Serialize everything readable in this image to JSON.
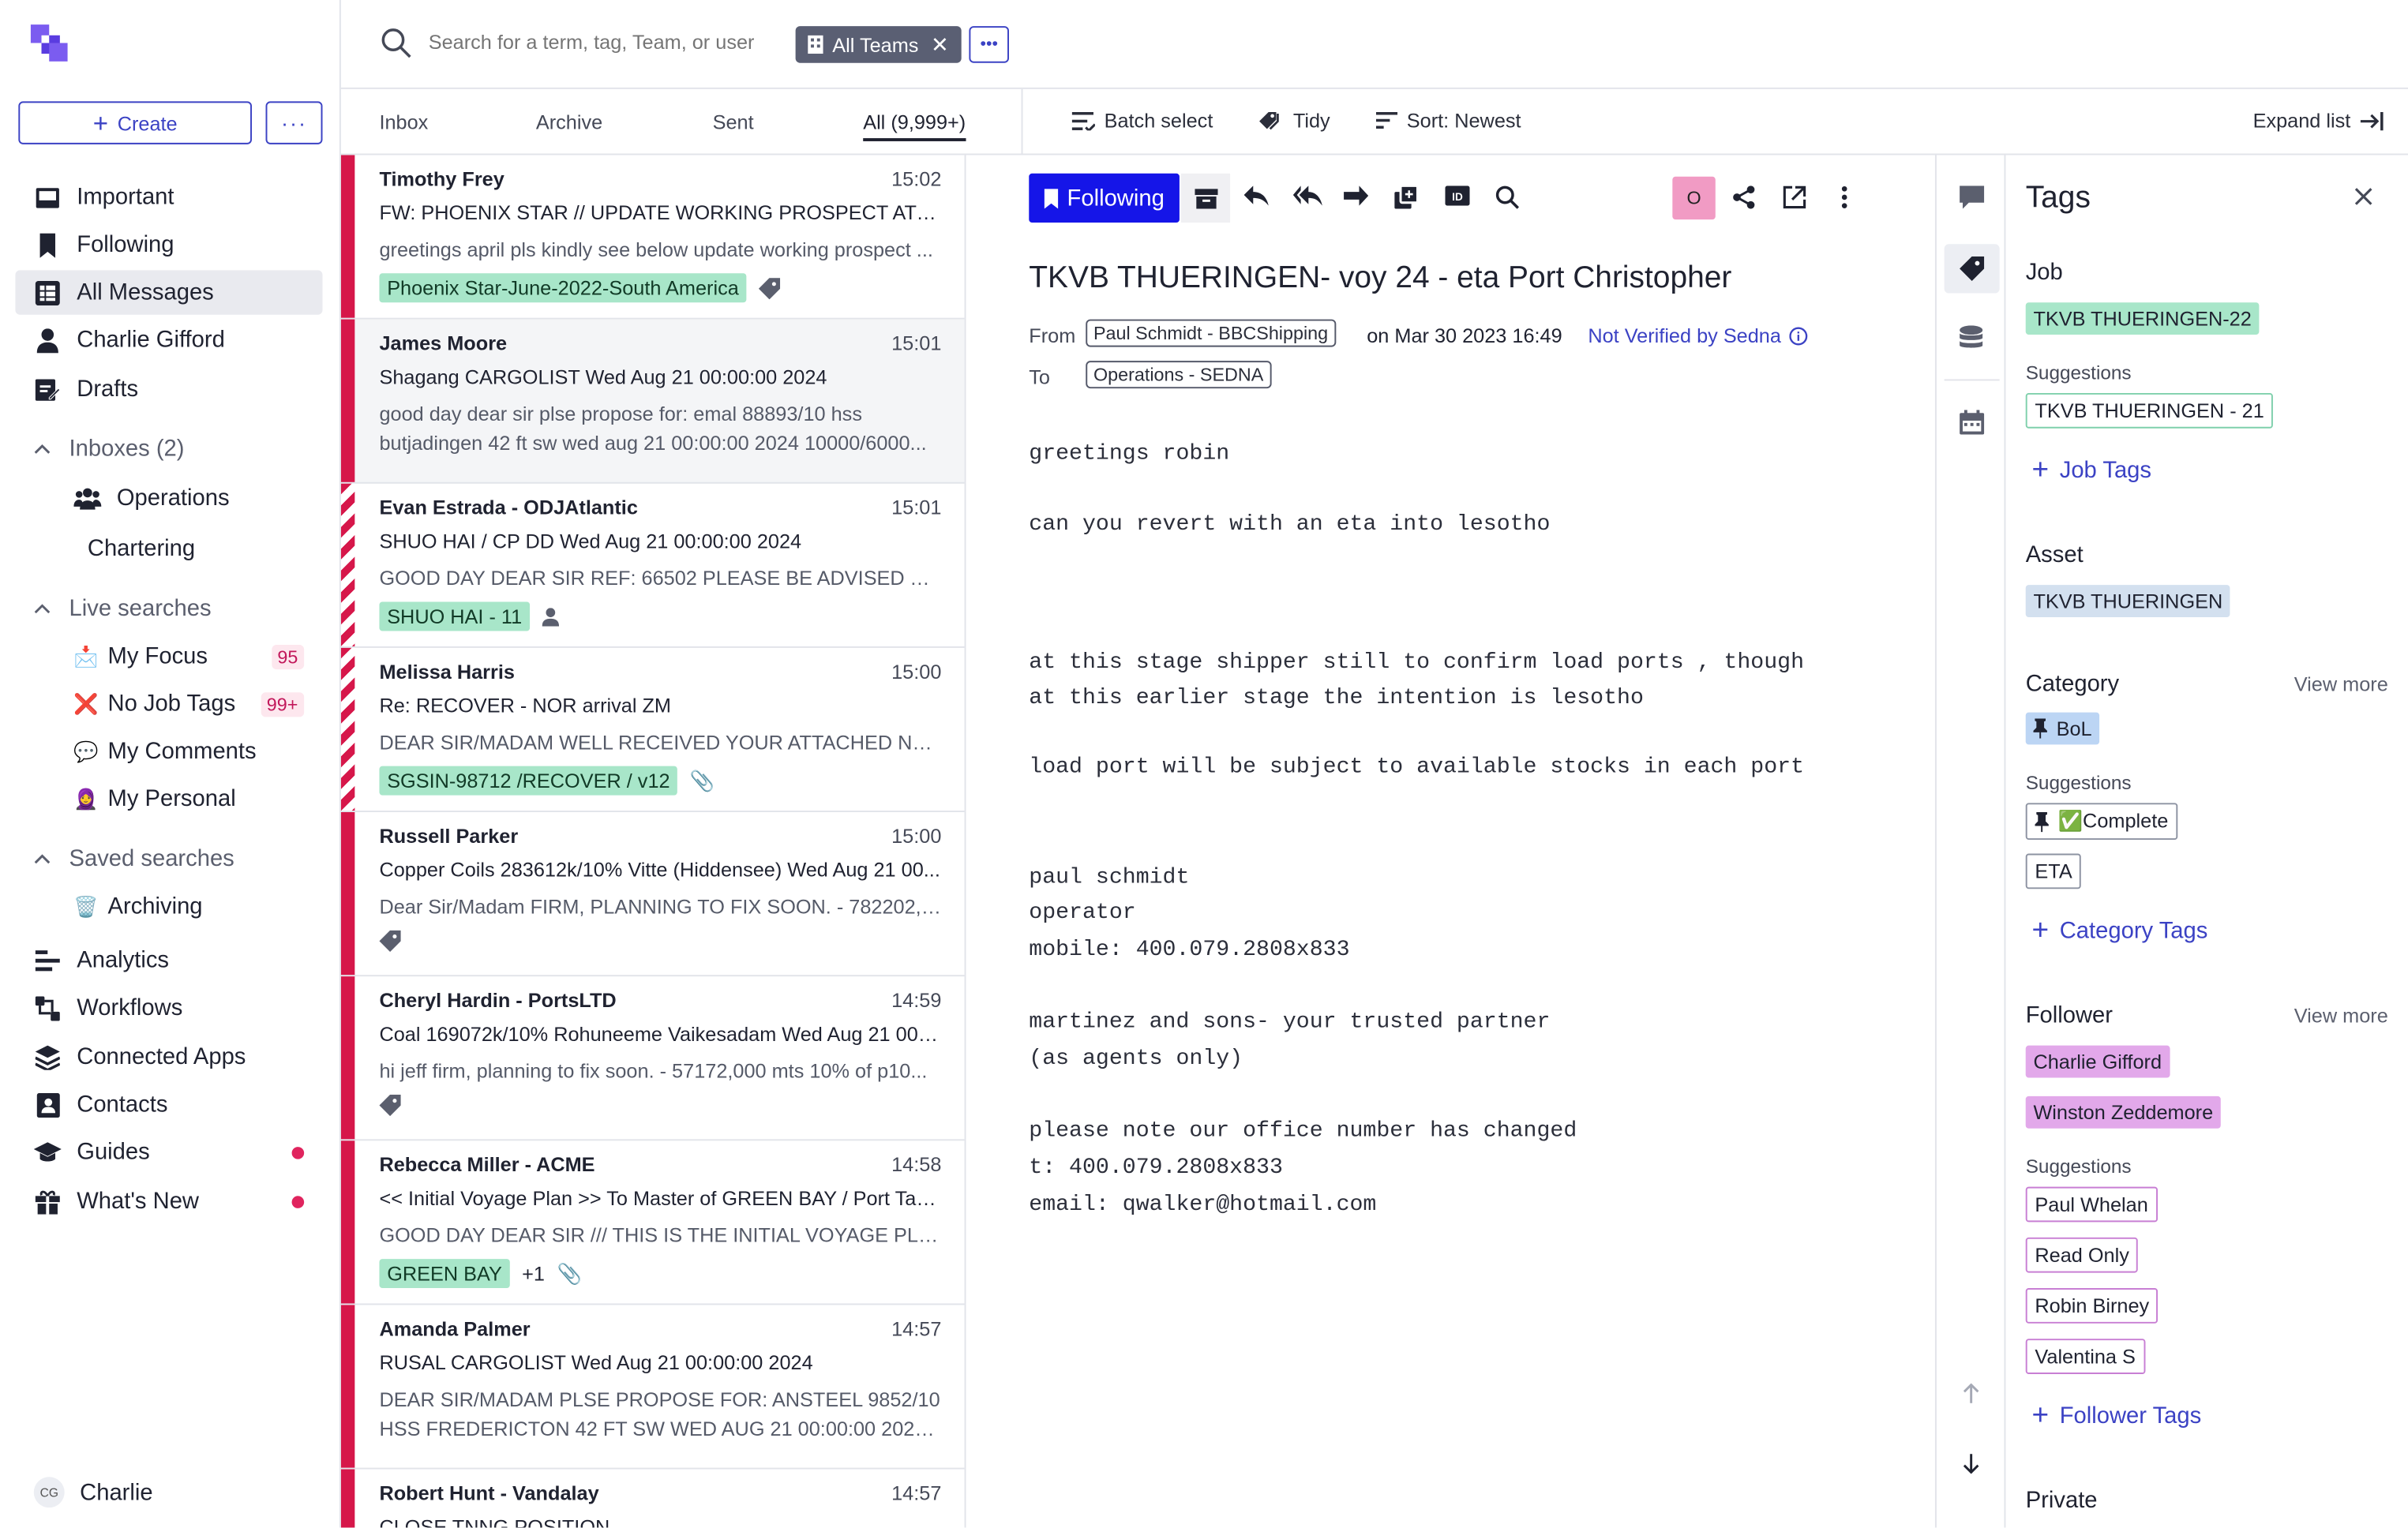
{
  "sidebar": {
    "create_label": "Create",
    "more_label": "···",
    "nav": [
      {
        "label": "Important",
        "icon": "inbox-icon"
      },
      {
        "label": "Following",
        "icon": "bookmark-icon"
      },
      {
        "label": "All Messages",
        "icon": "grid-icon"
      },
      {
        "label": "Charlie Gifford",
        "icon": "person-icon"
      },
      {
        "label": "Drafts",
        "icon": "draft-icon"
      }
    ],
    "inboxes_label": "Inboxes (2)",
    "inboxes": [
      {
        "label": "Operations"
      },
      {
        "label": "Chartering"
      }
    ],
    "live_label": "Live searches",
    "live": [
      {
        "label": "My Focus",
        "emoji": "📩",
        "count": "95"
      },
      {
        "label": "No Job Tags",
        "emoji": "❌",
        "count": "99+"
      },
      {
        "label": "My Comments",
        "emoji": "💬"
      },
      {
        "label": "My Personal",
        "emoji": "🧕"
      }
    ],
    "saved_label": "Saved searches",
    "saved": [
      {
        "label": "Archiving",
        "emoji": "🗑️"
      }
    ],
    "bottom_nav": [
      {
        "label": "Analytics"
      },
      {
        "label": "Workflows"
      },
      {
        "label": "Connected Apps"
      },
      {
        "label": "Contacts"
      },
      {
        "label": "Guides"
      },
      {
        "label": "What's New"
      }
    ],
    "user_initials": "CG",
    "user_name": "Charlie"
  },
  "search": {
    "placeholder": "Search for a term, tag, Team, or user",
    "teams_chip": "All Teams"
  },
  "tabs": {
    "inbox": "Inbox",
    "archive": "Archive",
    "sent": "Sent",
    "all": "All (9,999+)",
    "batch": "Batch select",
    "tidy": "Tidy",
    "sort": "Sort: Newest",
    "expand": "Expand list"
  },
  "messages": [
    {
      "from": "Timothy Frey",
      "time": "15:02",
      "subject": "FW: PHOENIX STAR // UPDATE WORKING PROSPECT AT Han...",
      "preview": [
        "greetings april pls kindly see below update working prospect ..."
      ],
      "tag": "Phoenix Star-June-2022-South America"
    },
    {
      "from": "James Moore",
      "time": "15:01",
      "subject": "Shagang CARGOLIST Wed Aug 21 00:00:00 2024",
      "preview": [
        "good day dear sir plse propose for: emal 88893/10 hss",
        "butjadingen 42 ft sw wed aug 21 00:00:00 2024 10000/6000..."
      ]
    },
    {
      "from": "Evan Estrada - ODJAtlantic",
      "time": "15:01",
      "subject": "SHUO HAI / CP DD Wed Aug 21 00:00:00 2024",
      "preview": [
        "GOOD DAY DEAR SIR REF: 66502 PLEASE BE ADVISED THAT..."
      ],
      "tag": "SHUO HAI - 11"
    },
    {
      "from": "Melissa Harris",
      "time": "15:00",
      "subject": "Re: RECOVER - NOR arrival ZM",
      "preview": [
        "DEAR SIR/MADAM WELL RECEIVED YOUR ATTACHED NOR ..."
      ],
      "tag": "SGSIN-98712 /RECOVER / v12"
    },
    {
      "from": "Russell Parker",
      "time": "15:00",
      "subject": "Copper Coils 283612k/10% Vitte (Hiddensee) Wed Aug 21 00...",
      "preview": [
        "Dear Sir/Madam FIRM, PLANNING TO FIX SOON. - 782202,0..."
      ]
    },
    {
      "from": "Cheryl Hardin - PortsLTD",
      "time": "14:59",
      "subject": "Coal 169072k/10% Rohuneeme Vaikesadam Wed Aug 21 00:0...",
      "preview": [
        "hi jeff firm, planning to fix soon. - 57172,000 mts 10% of p10..."
      ]
    },
    {
      "from": "Rebecca Miller - ACME",
      "time": "14:58",
      "subject": "<< Initial Voyage Plan >> To Master of GREEN BAY / Port Tan...",
      "preview": [
        "GOOD DAY DEAR SIR /// THIS IS THE INITIAL VOYAGE PLAN ..."
      ],
      "tag": "GREEN BAY",
      "extra": "+1"
    },
    {
      "from": "Amanda Palmer",
      "time": "14:57",
      "subject": "RUSAL CARGOLIST Wed Aug 21 00:00:00 2024",
      "preview": [
        "DEAR SIR/MADAM PLSE PROPOSE FOR: ANSTEEL 9852/10",
        "HSS FREDERICTON 42 FT SW WED AUG 21 00:00:00 2024..."
      ]
    },
    {
      "from": "Robert Hunt - Vandalay",
      "time": "14:57",
      "subject": "CLOSE TNNG POSITION",
      "preview": []
    }
  ],
  "reader": {
    "following_label": "Following",
    "avatar_letter": "O",
    "subject": "TKVB THUERINGEN- voy 24 - eta Port Christopher",
    "from_label": "From",
    "from_addr": "Paul Schmidt - BBCShipping",
    "date": "on Mar 30 2023 16:49",
    "verify": "Not Verified by Sedna",
    "to_label": "To",
    "to_addr": "Operations - SEDNA",
    "body": [
      "greetings robin",
      "can you revert with an eta into lesotho",
      "at this stage shipper still to confirm load ports , though",
      "at this earlier stage the intention is lesotho",
      "load port will be subject to available stocks in each port",
      "paul schmidt",
      "operator",
      "mobile: 400.079.2808x833",
      "martinez and sons- your trusted partner",
      "(as agents only)",
      "please note our office number has changed",
      "t: 400.079.2808x833",
      "email: qwalker@hotmail.com"
    ]
  },
  "tags_panel": {
    "title": "Tags",
    "job_label": "Job",
    "job_tag": "TKVB THUERINGEN-22",
    "suggestions_label": "Suggestions",
    "job_sugg": "TKVB THUERINGEN - 21",
    "add_job": "Job Tags",
    "asset_label": "Asset",
    "asset_tag": "TKVB THUERINGEN",
    "category_label": "Category",
    "view_more": "View more",
    "category_tag": "BoL",
    "cat_sugg": [
      "✅Complete",
      "ETA"
    ],
    "add_category": "Category Tags",
    "follower_label": "Follower",
    "followers": [
      "Charlie Gifford",
      "Winston Zeddemore"
    ],
    "follower_sugg": [
      "Paul Whelan",
      "Read Only",
      "Robin Birney",
      "Valentina S"
    ],
    "add_follower": "Follower Tags",
    "private_label": "Private"
  },
  "colors": {
    "accent": "#3b42c4",
    "following_bg": "#1515e8",
    "unread_bar": "#d6174a",
    "job_tag": "#a8e6c9",
    "follower_tag": "#e2a8ea"
  }
}
